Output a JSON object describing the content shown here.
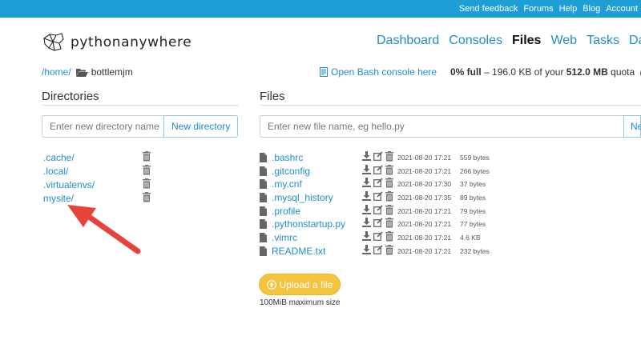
{
  "topbar": {
    "links": [
      "Send feedback",
      "Forums",
      "Help",
      "Blog",
      "Account"
    ]
  },
  "logo": {
    "text": "pythonanywhere"
  },
  "nav": {
    "items": [
      "Dashboard",
      "Consoles",
      "Files",
      "Web",
      "Tasks",
      "Data"
    ],
    "active": "Files"
  },
  "breadcrumb": {
    "home": "/home/",
    "current": "bottlemjm"
  },
  "bash_link": "Open Bash console here",
  "quota": {
    "percent": "0% full",
    "used": "196.0 KB",
    "of_text": "of your",
    "total": "512.0 MB",
    "quota_word": "quota",
    "badge": "M"
  },
  "directories": {
    "title": "Directories",
    "input_placeholder": "Enter new directory name",
    "button": "New directory",
    "items": [
      ".cache/",
      ".local/",
      ".virtualenvs/",
      "mysite/"
    ]
  },
  "files": {
    "title": "Files",
    "input_placeholder": "Enter new file name, eg hello.py",
    "button": "New",
    "items": [
      {
        "name": ".bashrc",
        "date": "2021-08-20 17:21",
        "size": "559 bytes"
      },
      {
        "name": ".gitconfig",
        "date": "2021-08-20 17:21",
        "size": "266 bytes"
      },
      {
        "name": ".my.cnf",
        "date": "2021-08-20 17:30",
        "size": "37 bytes"
      },
      {
        "name": ".mysql_history",
        "date": "2021-08-20 17:35",
        "size": "89 bytes"
      },
      {
        "name": ".profile",
        "date": "2021-08-20 17:21",
        "size": "79 bytes"
      },
      {
        "name": ".pythonstartup.py",
        "date": "2021-08-20 17:21",
        "size": "77 bytes"
      },
      {
        "name": ".vimrc",
        "date": "2021-08-20 17:21",
        "size": "4.6 KB"
      },
      {
        "name": "README.txt",
        "date": "2021-08-20 17:21",
        "size": "232 bytes"
      }
    ]
  },
  "upload": {
    "button": "Upload a file",
    "note": "100MiB maximum size"
  },
  "colors": {
    "topbar": "#1d9fd6",
    "link": "#1d8ecf",
    "upload": "#f5c43f",
    "arrow": "#e8433a"
  }
}
